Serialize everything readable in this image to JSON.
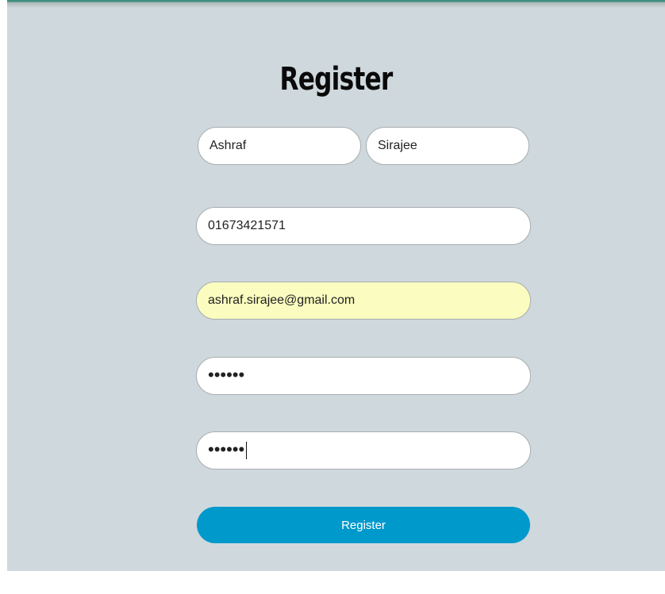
{
  "form": {
    "title": "Register",
    "first_name": {
      "value": "Ashraf",
      "placeholder": ""
    },
    "last_name": {
      "value": "Sirajee",
      "placeholder": ""
    },
    "phone": {
      "value": "01673421571",
      "placeholder": ""
    },
    "email": {
      "value": "ashraf.sirajee@gmail.com",
      "placeholder": ""
    },
    "password": {
      "value": "abcdef",
      "placeholder": ""
    },
    "confirm_password": {
      "value": "abcdef",
      "placeholder": ""
    },
    "submit_label": "Register"
  },
  "colors": {
    "background": "#cfd8dc",
    "button": "#0099cc",
    "autofill": "#fafdbf",
    "top_accent": "#3c8f7f"
  }
}
